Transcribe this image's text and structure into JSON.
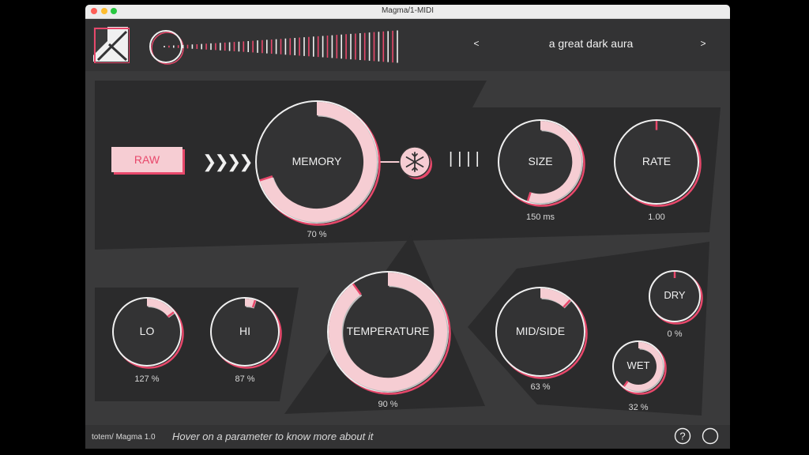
{
  "window": {
    "title": "Magma/1-MIDI"
  },
  "header": {
    "preset_prev": "<",
    "preset_next": ">",
    "preset_name": "a great dark aura"
  },
  "main": {
    "raw_label": "RAW",
    "knobs": {
      "memory": {
        "label": "MEMORY",
        "value": "70 %",
        "fill": 0.7
      },
      "size": {
        "label": "SIZE",
        "value": "150 ms",
        "fill": 0.55
      },
      "rate": {
        "label": "RATE",
        "value": "1.00",
        "fill": 0.0
      },
      "lo": {
        "label": "LO",
        "value": "127 %",
        "fill": 0.15
      },
      "hi": {
        "label": "HI",
        "value": "87 %",
        "fill": 0.05
      },
      "temperature": {
        "label": "TEMPERATURE",
        "value": "90 %",
        "fill": 0.9
      },
      "midside": {
        "label": "MID/SIDE",
        "value": "63 %",
        "fill": 0.12
      },
      "dry": {
        "label": "DRY",
        "value": "0 %",
        "fill": 0.0
      },
      "wet": {
        "label": "WET",
        "value": "32 %",
        "fill": 0.6
      }
    }
  },
  "footer": {
    "brand": "totem/ Magma 1.0",
    "hint": "Hover on a parameter to know more about it"
  },
  "colors": {
    "accent": "#e8486b",
    "fill": "#f6cdd3",
    "bg": "#3a3a3b",
    "panel": "#2b2b2c"
  }
}
